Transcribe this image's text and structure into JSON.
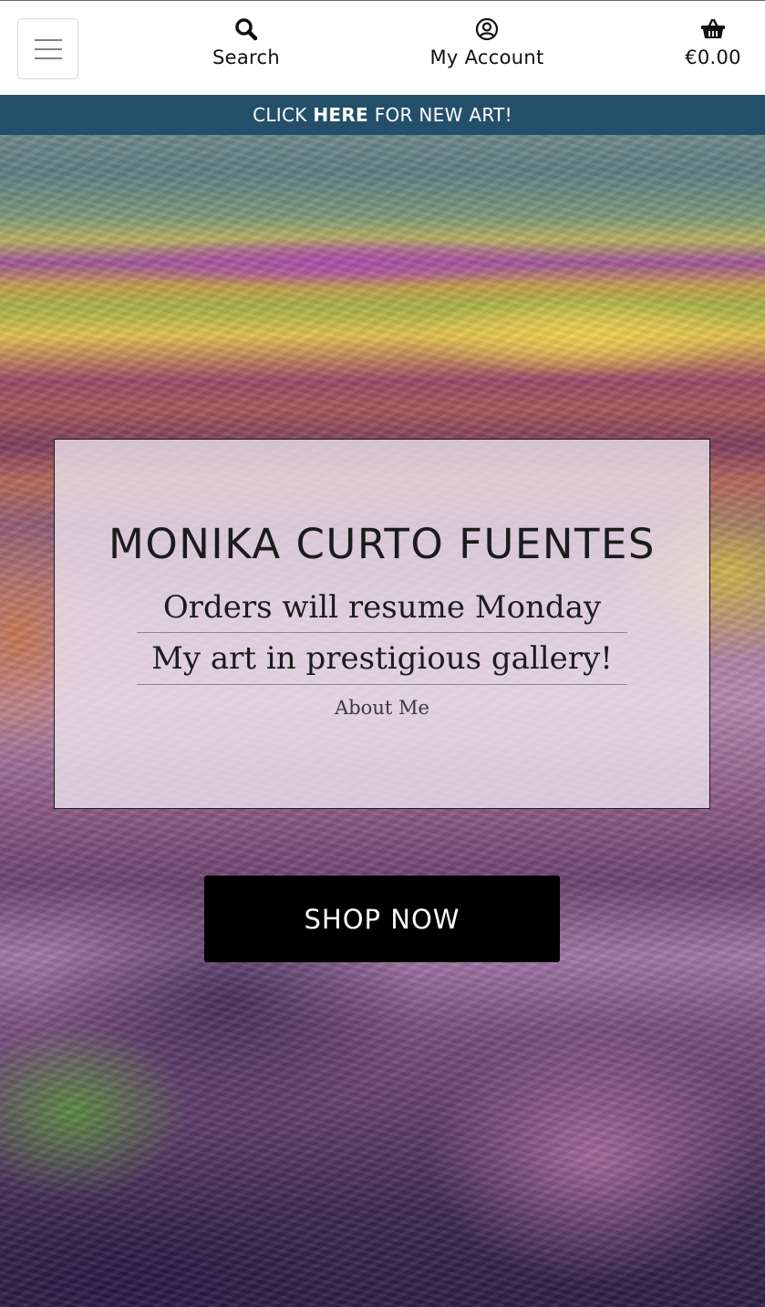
{
  "header": {
    "menu_icon": "hamburger-icon",
    "search": {
      "icon": "search-icon",
      "label": "Search"
    },
    "account": {
      "icon": "user-circle-icon",
      "label": "My Account"
    },
    "bag": {
      "icon": "shopping-basket-icon",
      "total": "€0.00"
    }
  },
  "banner": {
    "prefix": "CLICK",
    "link": "HERE",
    "suffix": "FOR NEW ART!",
    "background": "#244f6b"
  },
  "hero": {
    "brand": "MONIKA CURTO FUENTES",
    "line_1": "Orders will resume Monday",
    "line_2": "My art in prestigious gallery!",
    "about_link": "About Me",
    "shop_button": "SHOP NOW"
  }
}
